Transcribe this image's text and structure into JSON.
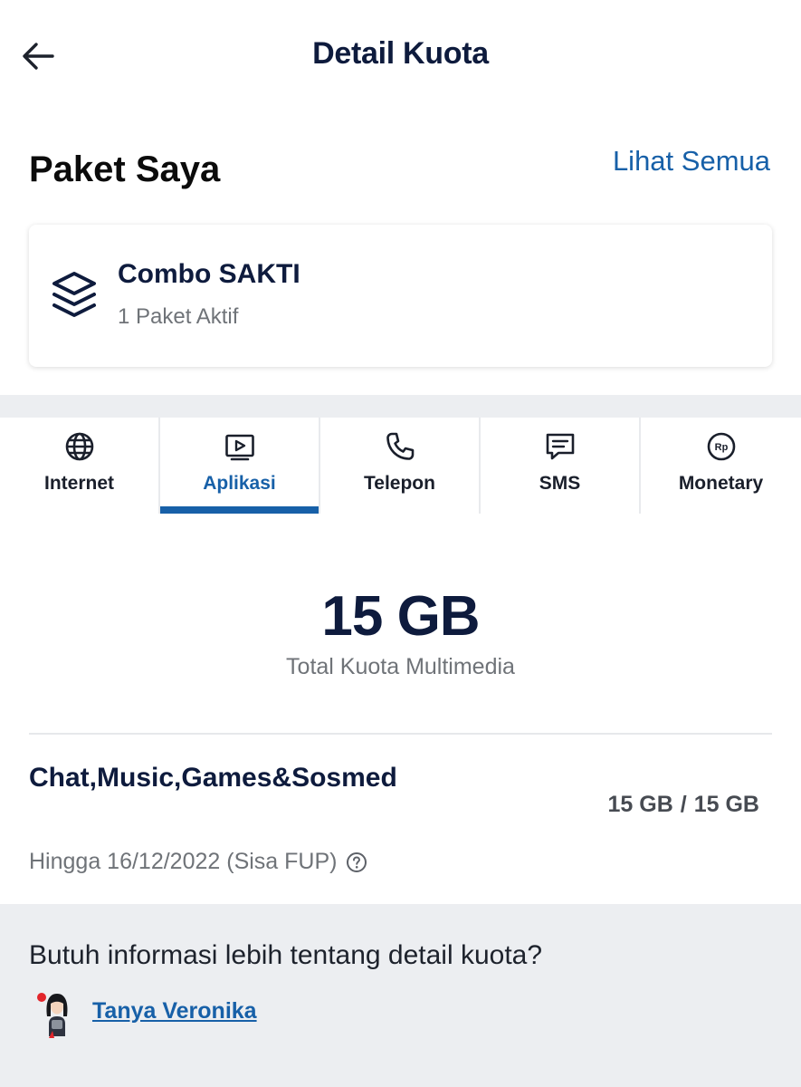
{
  "header": {
    "title": "Detail Kuota"
  },
  "section": {
    "title": "Paket Saya",
    "see_all": "Lihat Semua"
  },
  "package": {
    "name": "Combo SAKTI",
    "status": "1 Paket Aktif"
  },
  "tabs": [
    {
      "label": "Internet",
      "icon": "globe-icon",
      "active": false
    },
    {
      "label": "Aplikasi",
      "icon": "play-screen-icon",
      "active": true
    },
    {
      "label": "Telepon",
      "icon": "phone-icon",
      "active": false
    },
    {
      "label": "SMS",
      "icon": "message-icon",
      "active": false
    },
    {
      "label": "Monetary",
      "icon": "rupiah-coin-icon",
      "active": false
    }
  ],
  "quota": {
    "total": "15 GB",
    "caption": "Total Kuota Multimedia",
    "items": [
      {
        "name": "Chat,Music,Games&Sosmed",
        "remaining": "15 GB",
        "separator": "/",
        "total": "15 GB",
        "expiry": "Hingga 16/12/2022 (Sisa FUP)"
      }
    ]
  },
  "info": {
    "question": "Butuh informasi lebih tentang detail kuota?",
    "link": "Tanya Veronika"
  },
  "colors": {
    "accent": "#1760a8",
    "title": "#0e1b3d",
    "muted": "#6f7378",
    "band": "#eceef1"
  }
}
